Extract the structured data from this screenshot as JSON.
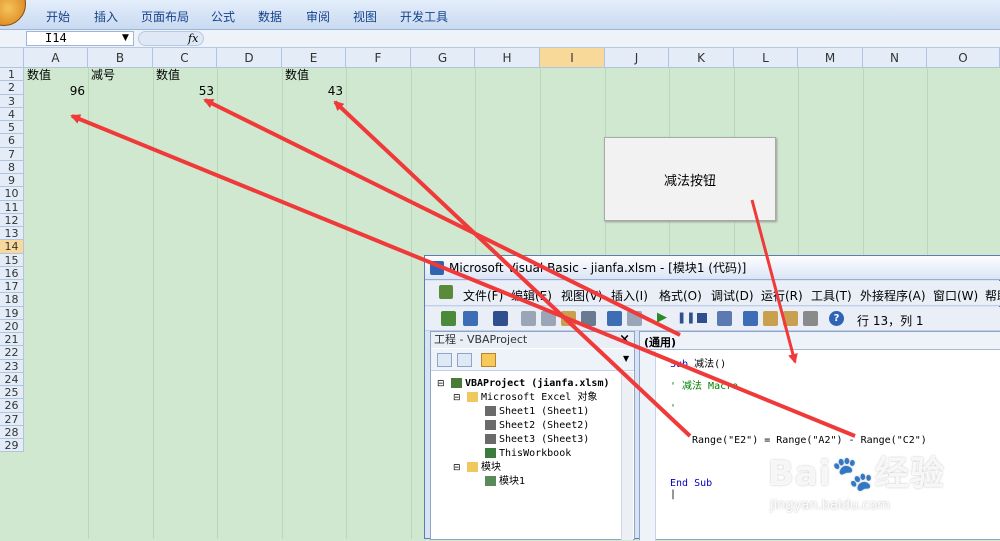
{
  "ribbon": {
    "tabs": [
      "开始",
      "插入",
      "页面布局",
      "公式",
      "数据",
      "审阅",
      "视图",
      "开发工具"
    ]
  },
  "formula_bar": {
    "name_box": "I14",
    "fx_label": "fx"
  },
  "sheet": {
    "columns": [
      "A",
      "B",
      "C",
      "D",
      "E",
      "F",
      "G",
      "H",
      "I",
      "J",
      "K",
      "L",
      "M",
      "N",
      "O"
    ],
    "selected_column": "I",
    "rows": [
      "1",
      "2",
      "3",
      "4",
      "5",
      "6",
      "7",
      "8",
      "9",
      "10",
      "11",
      "12",
      "13",
      "14",
      "15",
      "16",
      "17",
      "18",
      "19",
      "20",
      "21",
      "22",
      "23",
      "24",
      "25",
      "26",
      "27",
      "28",
      "29"
    ],
    "selected_row": "14",
    "cells": {
      "A1": "数值",
      "B1": "减号",
      "C1": "数值",
      "E1": "数值",
      "A2": "96",
      "C2": "53",
      "E2": "43"
    },
    "button_label": "减法按钮"
  },
  "vbe": {
    "title": "Microsoft Visual Basic - jianfa.xlsm - [模块1 (代码)]",
    "menu": [
      "文件(F)",
      "编辑(E)",
      "视图(V)",
      "插入(I)",
      "格式(O)",
      "调试(D)",
      "运行(R)",
      "工具(T)",
      "外接程序(A)",
      "窗口(W)",
      "帮助"
    ],
    "cursor_position": "行 13，列 1",
    "project_pane": {
      "title": "工程 - VBAProject",
      "close": "×",
      "tree": {
        "root": "VBAProject (jianfa.xlsm)",
        "excel_objects": "Microsoft Excel 对象",
        "sheet1": "Sheet1 (Sheet1)",
        "sheet2": "Sheet2 (Sheet2)",
        "sheet3": "Sheet3 (Sheet3)",
        "workbook": "ThisWorkbook",
        "modules": "模块",
        "module1": "模块1"
      }
    },
    "code_pane": {
      "scope": "(通用)",
      "lines": {
        "sub_kw": "Sub",
        "sub_name": " 减法()",
        "comment1": "' 减法 Macro",
        "comment2": "'",
        "statement": "Range(\"E2\") = Range(\"A2\") - Range(\"C2\")",
        "end_sub": "End Sub",
        "caret": "|"
      }
    }
  },
  "watermark": {
    "text": "Bai🐾经验",
    "url": "jingyan.baidu.com"
  },
  "colors": {
    "arrow": "#f03a3a",
    "sheet_bg": "#cfe8cf",
    "selection": "#f9d99a"
  }
}
